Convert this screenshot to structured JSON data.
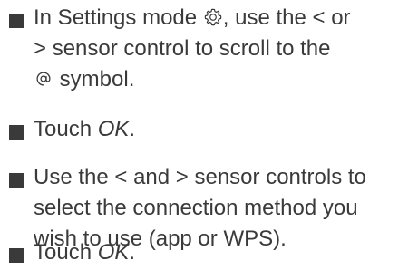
{
  "instructions": {
    "item1": {
      "l1_a": "In Settings mode",
      "l1_b": ", use the",
      "l1_c": "or",
      "l2_a": "sensor control to scroll to the",
      "l3_a": "symbol."
    },
    "item2": {
      "a": "Touch",
      "b": "OK",
      "c": "."
    },
    "item3": {
      "l1_a": "Use the",
      "l1_b": "and",
      "l1_c": "sensor controls to",
      "l2": "select the connection method you",
      "l3": "wish to use (app or WPS)."
    },
    "item4": {
      "a": "Touch",
      "b": "OK",
      "c": "."
    }
  },
  "symbols": {
    "lt": "<",
    "gt": ">"
  },
  "icons": {
    "settings": "gear-icon",
    "connect": "at-sign-icon"
  },
  "colors": {
    "text": "#3a3a3a"
  }
}
